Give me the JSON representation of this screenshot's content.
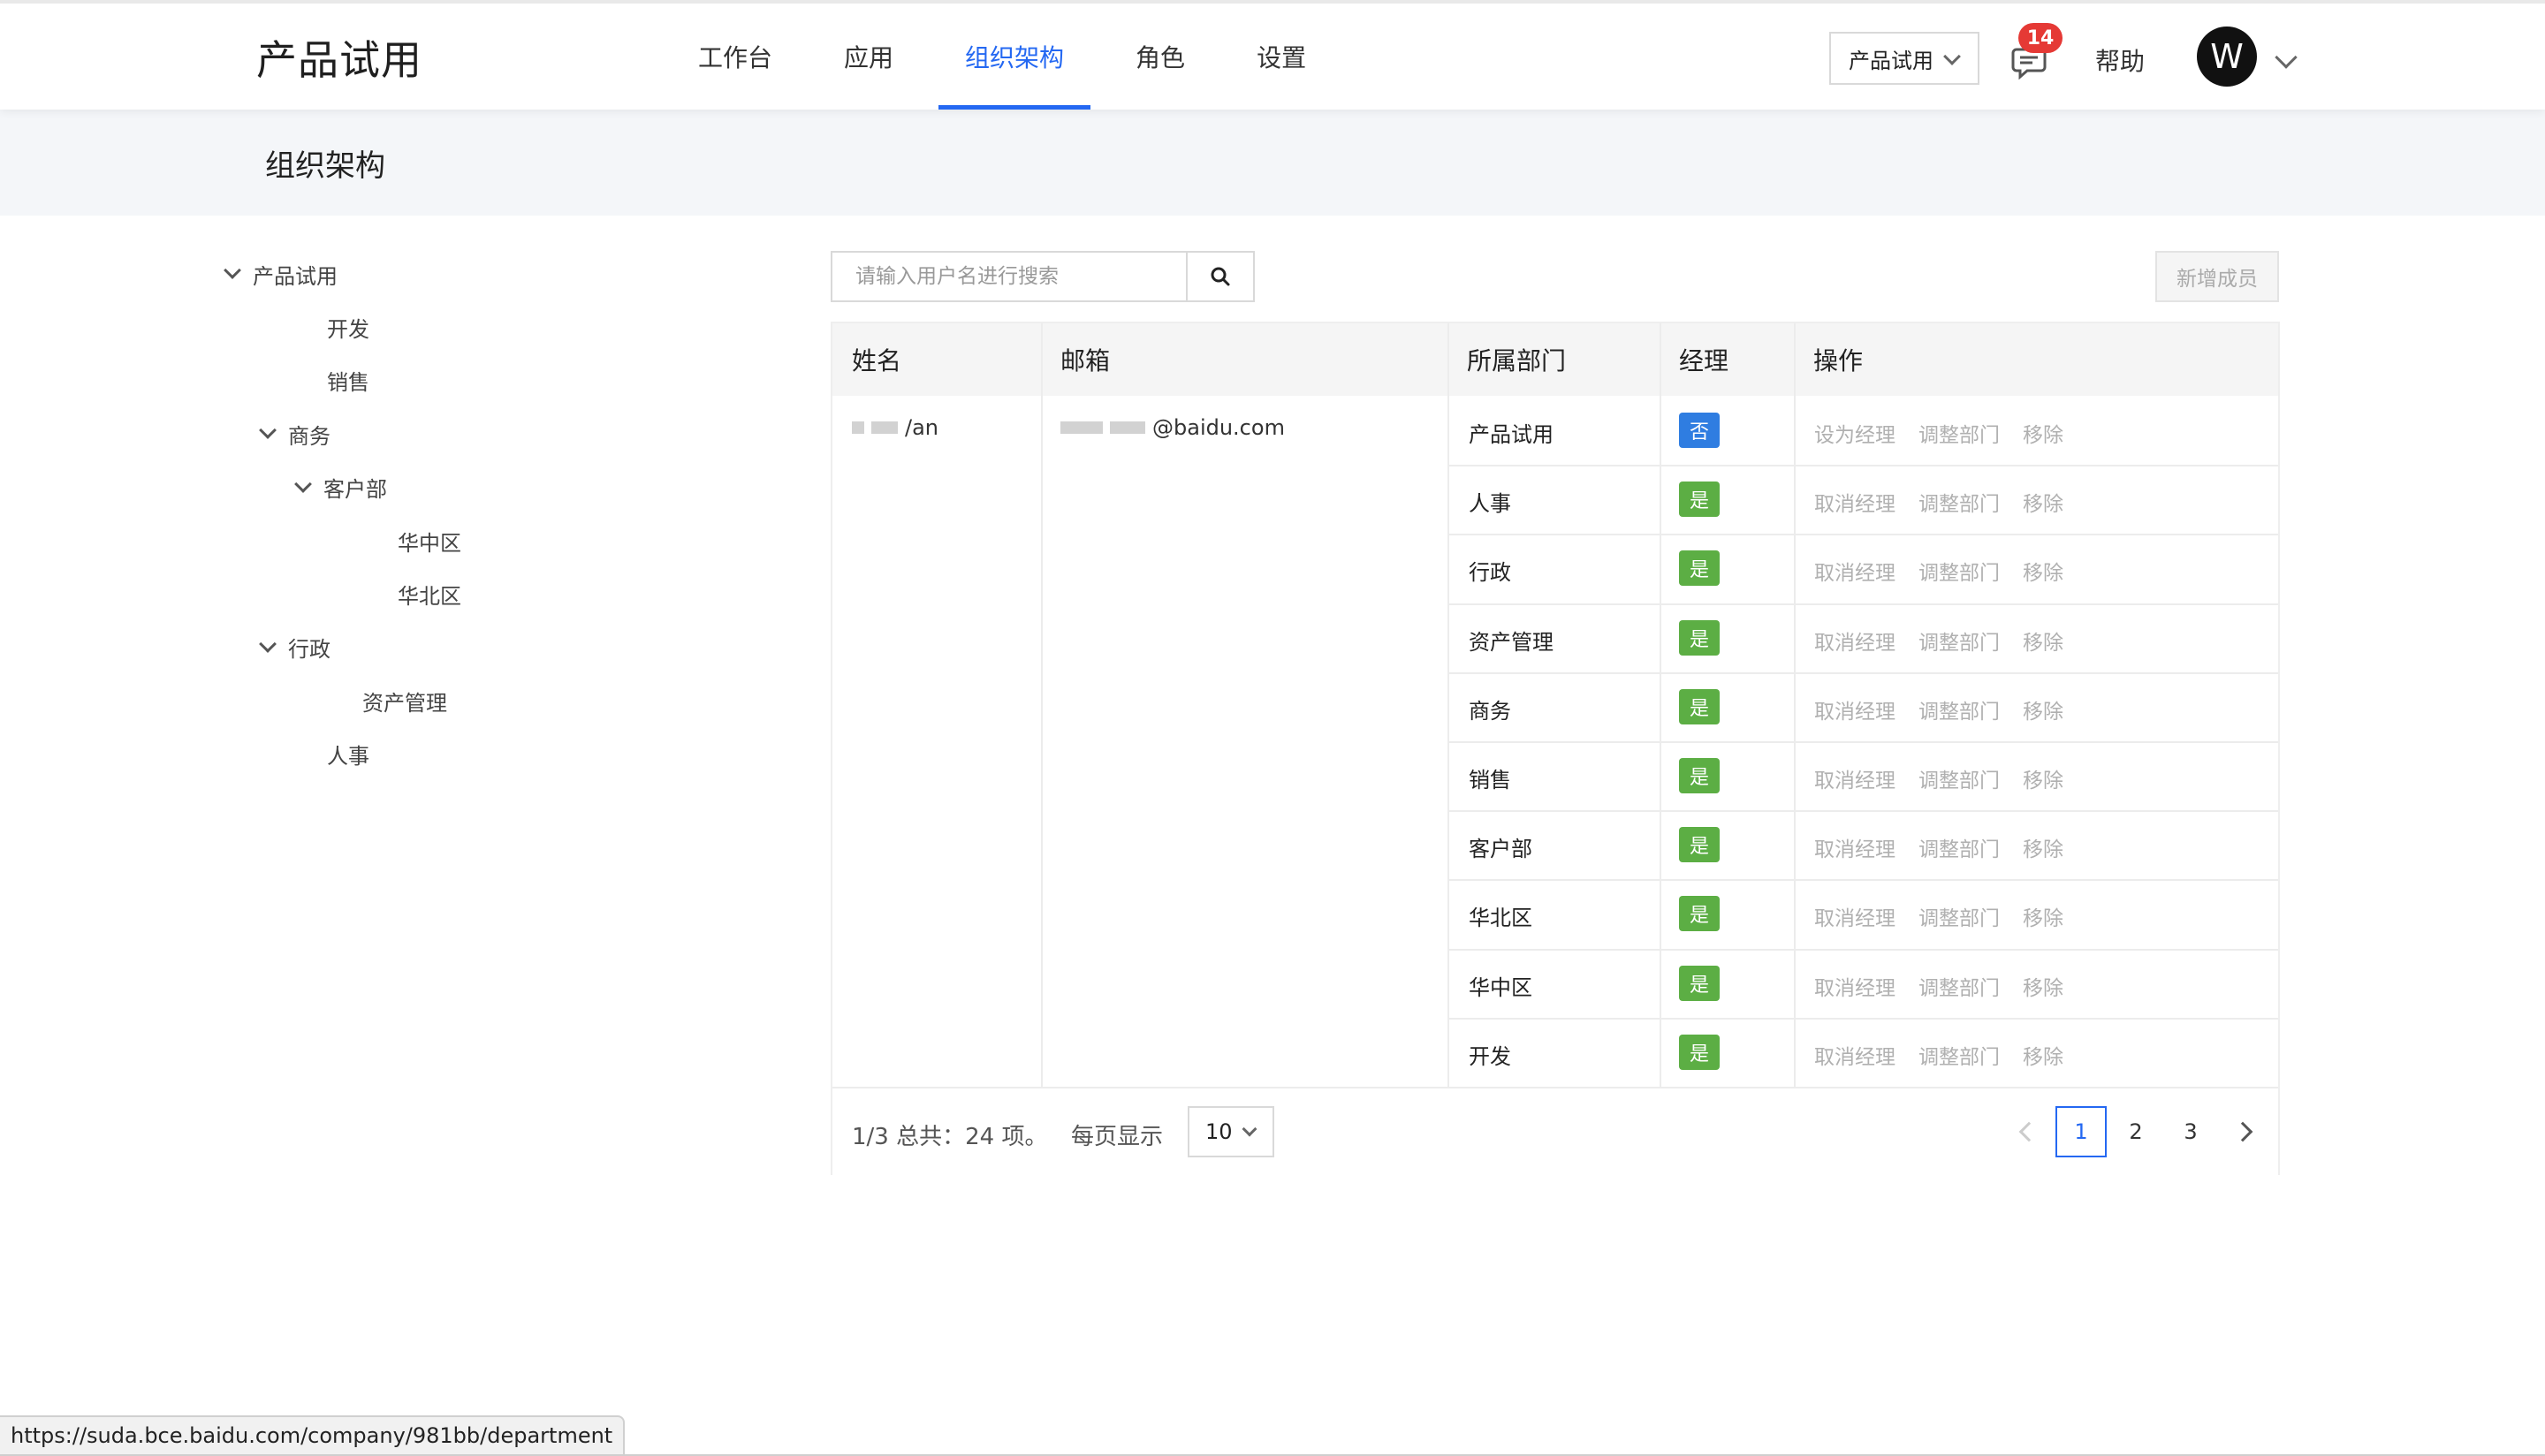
{
  "brand": "产品试用",
  "nav": [
    {
      "label": "工作台",
      "active": false
    },
    {
      "label": "应用",
      "active": false
    },
    {
      "label": "组织架构",
      "active": true
    },
    {
      "label": "角色",
      "active": false
    },
    {
      "label": "设置",
      "active": false
    }
  ],
  "header": {
    "org_select": "产品试用",
    "message_count": "14",
    "help": "帮助",
    "avatar_initial": "W"
  },
  "page_title": "组织架构",
  "tree": [
    {
      "label": "产品试用",
      "level": 0,
      "expanded": true
    },
    {
      "label": "开发",
      "level": 1,
      "expanded": false
    },
    {
      "label": "销售",
      "level": 1,
      "expanded": false
    },
    {
      "label": "商务",
      "level": 1,
      "expanded": true
    },
    {
      "label": "客户部",
      "level": 2,
      "expanded": true
    },
    {
      "label": "华中区",
      "level": 3,
      "expanded": false
    },
    {
      "label": "华北区",
      "level": 3,
      "expanded": false
    },
    {
      "label": "行政",
      "level": 1,
      "expanded": true
    },
    {
      "label": "资产管理",
      "level": 2,
      "expanded": false
    },
    {
      "label": "人事",
      "level": 1,
      "expanded": false
    }
  ],
  "search": {
    "placeholder": "请输入用户名进行搜索"
  },
  "add_member": "新增成员",
  "table": {
    "headers": [
      "姓名",
      "邮箱",
      "所属部门",
      "经理",
      "操作"
    ],
    "user_name_visible": "/an",
    "user_email_visible": "@baidu.com",
    "rows": [
      {
        "dept": "产品试用",
        "manager": "否",
        "ops": [
          "设为经理",
          "调整部门",
          "移除"
        ]
      },
      {
        "dept": "人事",
        "manager": "是",
        "ops": [
          "取消经理",
          "调整部门",
          "移除"
        ]
      },
      {
        "dept": "行政",
        "manager": "是",
        "ops": [
          "取消经理",
          "调整部门",
          "移除"
        ]
      },
      {
        "dept": "资产管理",
        "manager": "是",
        "ops": [
          "取消经理",
          "调整部门",
          "移除"
        ]
      },
      {
        "dept": "商务",
        "manager": "是",
        "ops": [
          "取消经理",
          "调整部门",
          "移除"
        ]
      },
      {
        "dept": "销售",
        "manager": "是",
        "ops": [
          "取消经理",
          "调整部门",
          "移除"
        ]
      },
      {
        "dept": "客户部",
        "manager": "是",
        "ops": [
          "取消经理",
          "调整部门",
          "移除"
        ]
      },
      {
        "dept": "华北区",
        "manager": "是",
        "ops": [
          "取消经理",
          "调整部门",
          "移除"
        ]
      },
      {
        "dept": "华中区",
        "manager": "是",
        "ops": [
          "取消经理",
          "调整部门",
          "移除"
        ]
      },
      {
        "dept": "开发",
        "manager": "是",
        "ops": [
          "取消经理",
          "调整部门",
          "移除"
        ]
      }
    ]
  },
  "pagination": {
    "total_text": "1/3 总共：24 项。",
    "per_page_label": "每页显示",
    "page_size": "10",
    "pages": [
      "1",
      "2",
      "3"
    ],
    "current": "1"
  },
  "status_url": "https://suda.bce.baidu.com/company/981bb/department",
  "colors": {
    "accent": "#2468f2",
    "yes": "#5cae44",
    "no": "#2f7de1",
    "badge": "#e53935"
  }
}
